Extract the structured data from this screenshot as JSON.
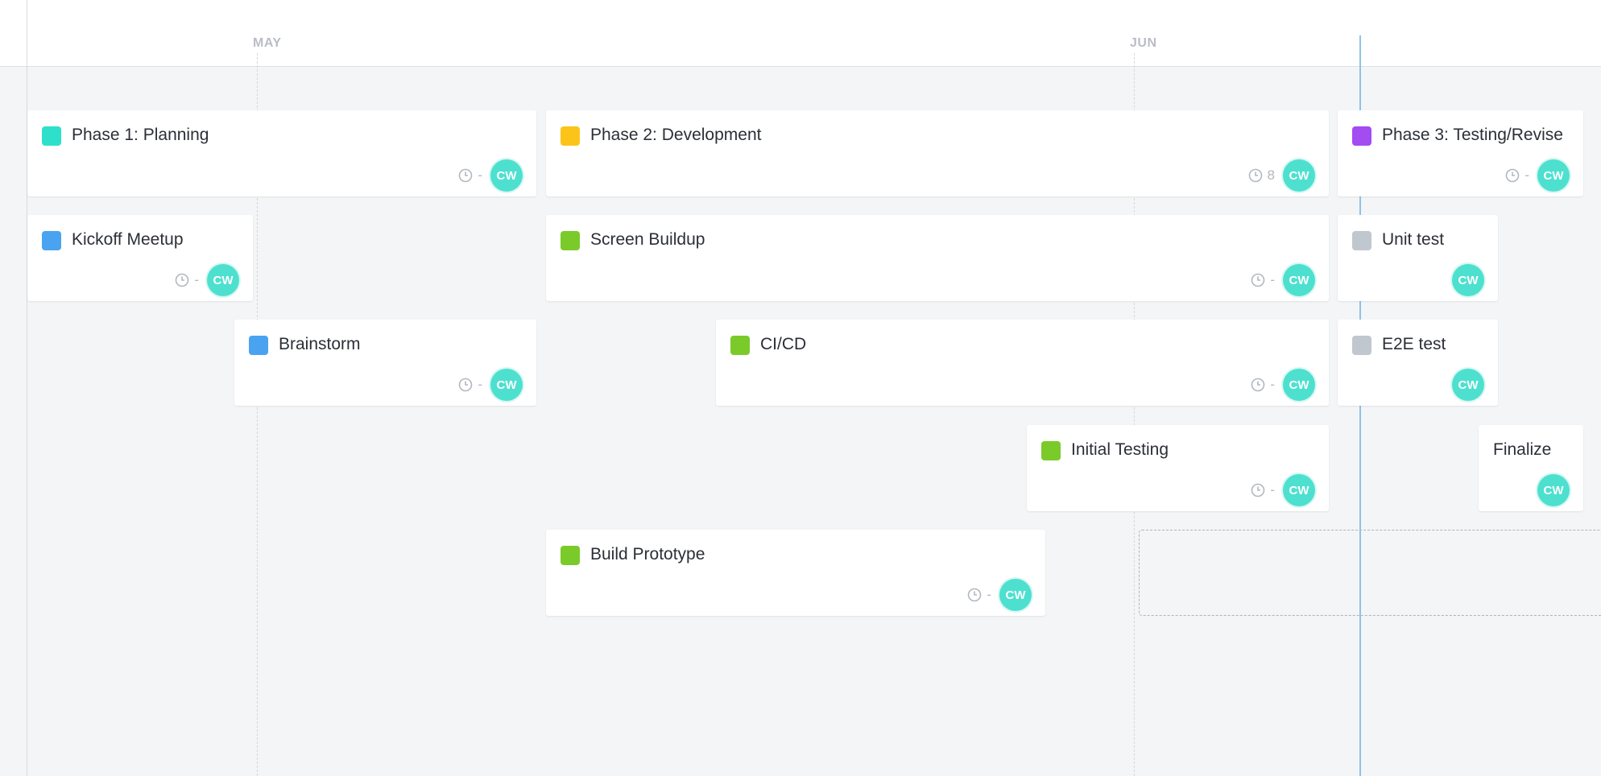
{
  "timeline": {
    "months": [
      {
        "label": "MAY"
      },
      {
        "label": "JUN"
      }
    ]
  },
  "tasks": [
    {
      "title": "Phase 1: Planning",
      "color": "#2ee0cc",
      "hours": "-",
      "assignee": "CW"
    },
    {
      "title": "Phase 2: Development",
      "color": "#fcc419",
      "hours": "8",
      "assignee": "CW"
    },
    {
      "title": "Phase 3: Testing/Revise",
      "color": "#a34cf2",
      "hours": "-",
      "assignee": "CW"
    },
    {
      "title": "Kickoff Meetup",
      "color": "#4aa3f0",
      "hours": "-",
      "assignee": "CW"
    },
    {
      "title": "Screen Buildup",
      "color": "#7acb2a",
      "hours": "-",
      "assignee": "CW"
    },
    {
      "title": "Unit test",
      "color": "#c1c7cf",
      "hours": "",
      "assignee": "CW"
    },
    {
      "title": "Brainstorm",
      "color": "#4aa3f0",
      "hours": "-",
      "assignee": "CW"
    },
    {
      "title": "CI/CD",
      "color": "#7acb2a",
      "hours": "-",
      "assignee": "CW"
    },
    {
      "title": "E2E test",
      "color": "#c1c7cf",
      "hours": "",
      "assignee": "CW"
    },
    {
      "title": "Initial Testing",
      "color": "#7acb2a",
      "hours": "-",
      "assignee": "CW"
    },
    {
      "title": "Finalize",
      "color": "",
      "hours": "",
      "assignee": "CW"
    },
    {
      "title": "Build Prototype",
      "color": "#7acb2a",
      "hours": "-",
      "assignee": "CW"
    }
  ],
  "colors": {
    "today_line": "#8fc3e8",
    "avatar": "#4de0cf"
  }
}
